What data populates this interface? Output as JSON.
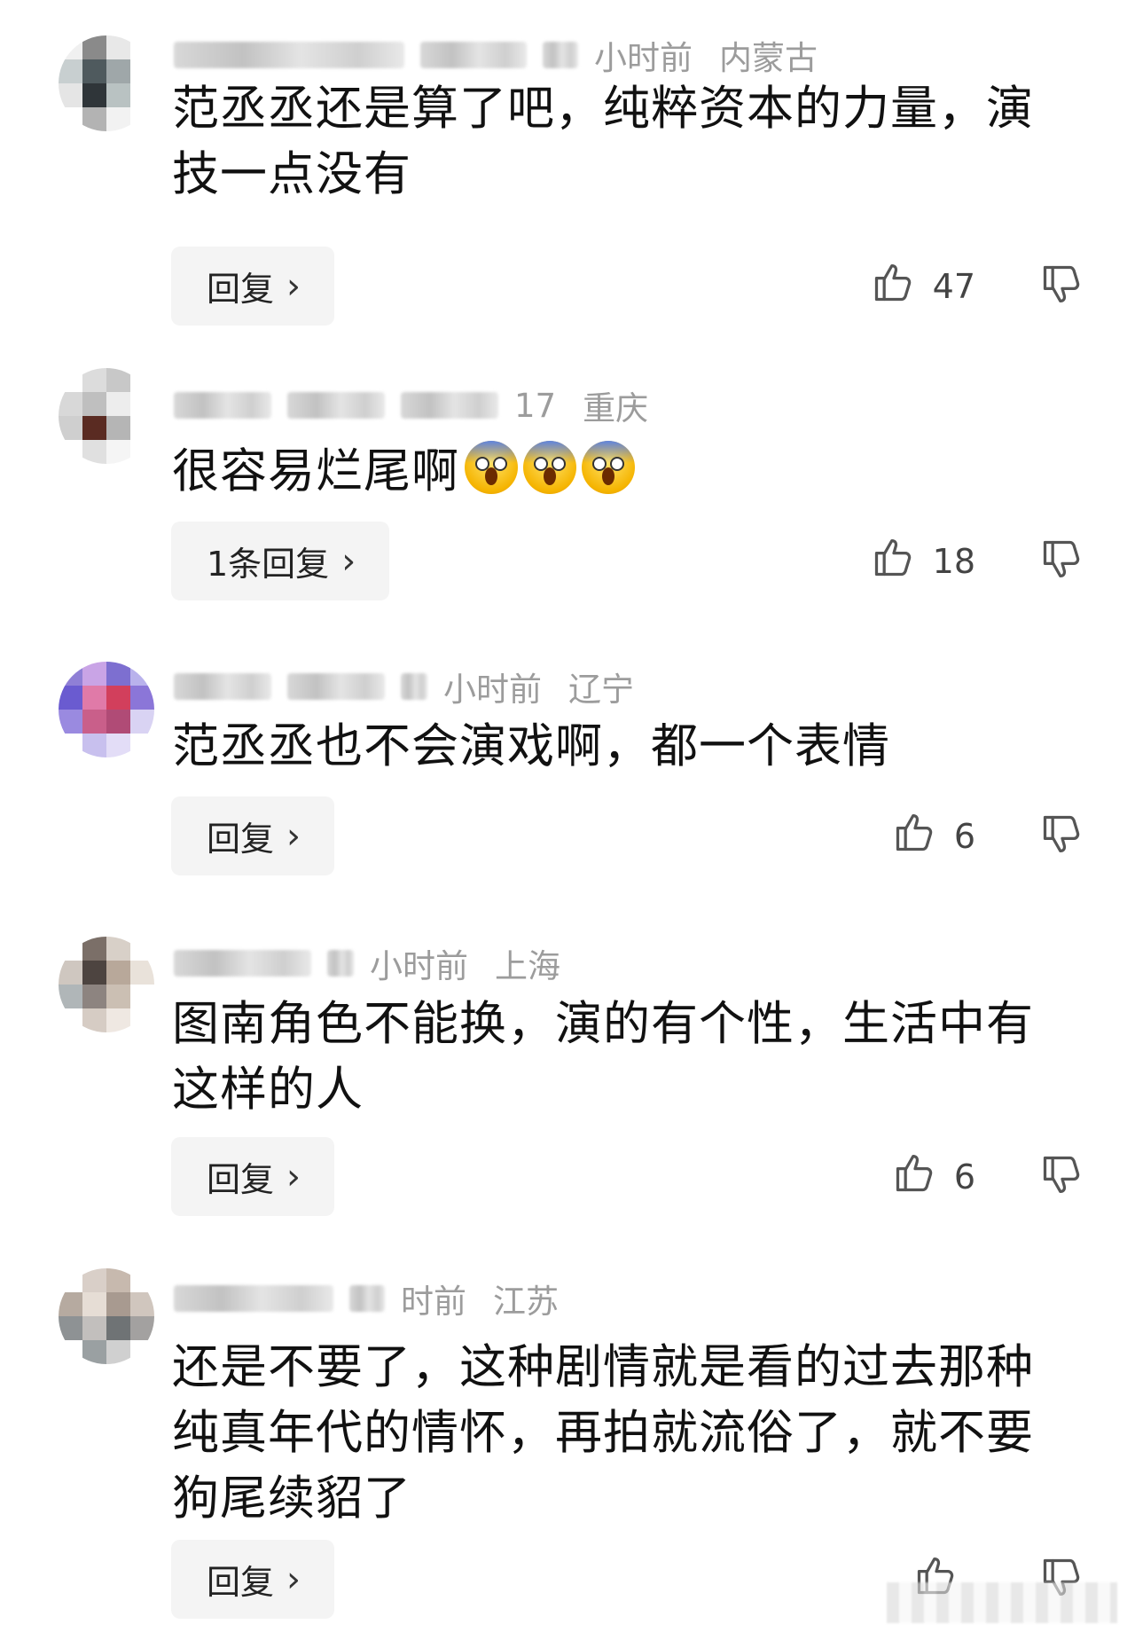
{
  "comments": [
    {
      "time": "小时前",
      "location": "内蒙古",
      "text": "范丞丞还是算了吧，纯粹资本的力量，演技一点没有",
      "emojis": 0,
      "reply_label": "回复",
      "likes": "47",
      "avatar_colors": [
        "#f0f0f0",
        "#8a8a8a",
        "#e8e8e8",
        "#ffffff",
        "#c8cfd0",
        "#4f5a5e",
        "#9fa7a9",
        "#ffffff",
        "#e5e5e5",
        "#2f3539",
        "#b9c2c2",
        "#ffffff",
        "#ffffff",
        "#b3b3b3",
        "#f2f2f2",
        "#ffffff"
      ]
    },
    {
      "time": "17",
      "location": "重庆",
      "text": "很容易烂尾啊",
      "emojis": 3,
      "reply_label": "1条回复",
      "likes": "18",
      "avatar_colors": [
        "#ffffff",
        "#dcdcdc",
        "#c8c8c8",
        "#ffffff",
        "#d8d8d8",
        "#bfbfbf",
        "#ededed",
        "#ffffff",
        "#cfcfcf",
        "#5a2b22",
        "#b5b5b5",
        "#ffffff",
        "#ffffff",
        "#e0e0e0",
        "#f5f5f5",
        "#ffffff"
      ]
    },
    {
      "time": "小时前",
      "location": "辽宁",
      "text": "范丞丞也不会演戏啊，都一个表情",
      "emojis": 0,
      "reply_label": "回复",
      "likes": "6",
      "avatar_colors": [
        "#8f7fd6",
        "#c9a4e6",
        "#7d6fd0",
        "#b9b2ec",
        "#6a5bd0",
        "#e07aa8",
        "#d23f5c",
        "#8b76d8",
        "#9a8ae0",
        "#c95f8a",
        "#b04b76",
        "#d9d3f3",
        "#ffffff",
        "#c8c0ee",
        "#e3ddf7",
        "#ffffff"
      ]
    },
    {
      "time": "小时前",
      "location": "上海",
      "text": "图南角色不能换，演的有个性，生活中有这样的人",
      "emojis": 0,
      "reply_label": "回复",
      "likes": "6",
      "avatar_colors": [
        "#ffffff",
        "#7b6f68",
        "#d8d0c8",
        "#ffffff",
        "#cfc7c0",
        "#4d4440",
        "#b8a89a",
        "#e9e2da",
        "#b0b6b8",
        "#8d8480",
        "#cbbfb3",
        "#ffffff",
        "#ffffff",
        "#d6ccc4",
        "#efe8e2",
        "#ffffff"
      ]
    },
    {
      "time": "时前",
      "location": "江苏",
      "text": "还是不要了，这种剧情就是看的过去那种纯真年代的情怀，再拍就流俗了，就不要狗尾续貂了",
      "emojis": 0,
      "reply_label": "回复",
      "likes": "",
      "avatar_colors": [
        "#ffffff",
        "#d9cfc8",
        "#c7b9ae",
        "#ffffff",
        "#b6aaa0",
        "#e6ddd5",
        "#a89a90",
        "#d0c6be",
        "#8e9294",
        "#c2bfbd",
        "#6f7375",
        "#a3a1a0",
        "#ffffff",
        "#9aa0a2",
        "#d0d0d0",
        "#ffffff"
      ]
    }
  ],
  "icons": {
    "like": "thumbs-up-icon",
    "dislike": "thumbs-down-icon",
    "chevron": "chevron-right-icon"
  },
  "colors": {
    "meta_text": "#9c9c9c",
    "reply_button_bg": "#f4f4f4",
    "body_text": "#111111"
  }
}
